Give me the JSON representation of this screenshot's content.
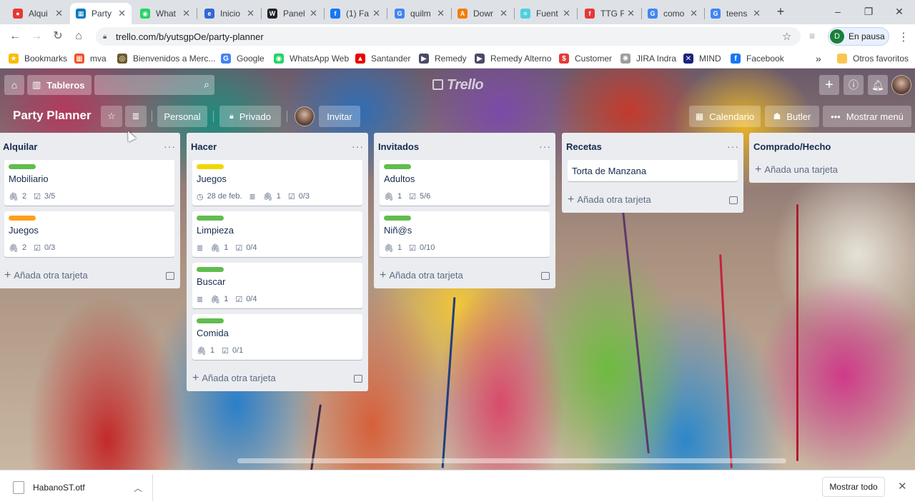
{
  "browser": {
    "tabs": [
      {
        "label": "Alqui",
        "color": "#e53935",
        "glyph": "●"
      },
      {
        "label": "Party",
        "color": "#0079bf",
        "glyph": "▦",
        "active": true
      },
      {
        "label": "What",
        "color": "#25d366",
        "glyph": "◉"
      },
      {
        "label": "Inicio",
        "color": "#3367d6",
        "glyph": "e"
      },
      {
        "label": "Panel",
        "color": "#222222",
        "glyph": "W"
      },
      {
        "label": "(1) Fa",
        "color": "#1877f2",
        "glyph": "f"
      },
      {
        "label": "quilm",
        "color": "#4285f4",
        "glyph": "G"
      },
      {
        "label": "Dowr",
        "color": "#f57c00",
        "glyph": "A"
      },
      {
        "label": "Fuent",
        "color": "#4dd0e1",
        "glyph": "≈"
      },
      {
        "label": "TTG F",
        "color": "#e53935",
        "glyph": "f"
      },
      {
        "label": "como",
        "color": "#4285f4",
        "glyph": "G"
      },
      {
        "label": "teens",
        "color": "#4285f4",
        "glyph": "G"
      }
    ],
    "url": "trello.com/b/yutsgpOe/party-planner",
    "profile": {
      "initial": "D",
      "status": "En pausa"
    },
    "bookmarks": [
      {
        "label": "Bookmarks",
        "color": "#fbbc04",
        "glyph": "★"
      },
      {
        "label": "mva",
        "color": "#f25022",
        "glyph": "▦"
      },
      {
        "label": "Bienvenidos a Merc...",
        "color": "#6b5b2a",
        "glyph": "◎"
      },
      {
        "label": "Google",
        "color": "#4285f4",
        "glyph": "G"
      },
      {
        "label": "WhatsApp Web",
        "color": "#25d366",
        "glyph": "◉"
      },
      {
        "label": "Santander",
        "color": "#ec0000",
        "glyph": "▲"
      },
      {
        "label": "Remedy",
        "color": "#4a4a6a",
        "glyph": "▶"
      },
      {
        "label": "Remedy Alterno",
        "color": "#4a4a6a",
        "glyph": "▶"
      },
      {
        "label": "Customer",
        "color": "#e53935",
        "glyph": "$"
      },
      {
        "label": "JIRA Indra",
        "color": "#9e9e9e",
        "glyph": "✺"
      },
      {
        "label": "MIND",
        "color": "#1a237e",
        "glyph": "✕"
      },
      {
        "label": "Facebook",
        "color": "#1877f2",
        "glyph": "f"
      }
    ],
    "bookmarks_more": "»",
    "other_favorites": "Otros favoritos"
  },
  "trello": {
    "tableros": "Tableros",
    "logo": "Trello",
    "board": {
      "title": "Party Planner",
      "personal": "Personal",
      "privado": "Privado",
      "invitar": "Invitar",
      "calendario": "Calendario",
      "butler": "Butler",
      "mostrar_menu": "Mostrar menú"
    },
    "lists": [
      {
        "title": "Alquilar",
        "add": "Añada otra tarjeta",
        "cards": [
          {
            "label": "#61bd4f",
            "title": "Mobiliario",
            "attachments": "2",
            "checklist": "3/5"
          },
          {
            "label": "#ff9f1a",
            "title": "Juegos",
            "attachments": "2",
            "checklist": "0/3"
          }
        ]
      },
      {
        "title": "Hacer",
        "add": "Añada otra tarjeta",
        "cards": [
          {
            "label": "#f2d600",
            "title": "Juegos",
            "due": "28 de feb.",
            "desc": true,
            "attachments": "1",
            "checklist": "0/3"
          },
          {
            "label": "#61bd4f",
            "title": "Limpieza",
            "desc": true,
            "attachments": "1",
            "checklist": "0/4"
          },
          {
            "label": "#61bd4f",
            "title": "Buscar",
            "desc": true,
            "attachments": "1",
            "checklist": "0/4"
          },
          {
            "label": "#61bd4f",
            "title": "Comida",
            "attachments": "1",
            "checklist": "0/1"
          }
        ]
      },
      {
        "title": "Invitados",
        "add": "Añada otra tarjeta",
        "cards": [
          {
            "label": "#61bd4f",
            "title": "Adultos",
            "attachments": "1",
            "checklist": "5/6"
          },
          {
            "label": "#61bd4f",
            "title": "Niñ@s",
            "attachments": "1",
            "checklist": "0/10"
          }
        ]
      },
      {
        "title": "Recetas",
        "add": "Añada otra tarjeta",
        "cards": [
          {
            "title": "Torta de Manzana"
          }
        ]
      },
      {
        "title": "Comprado/Hecho",
        "add": "Añada una tarjeta",
        "cards": []
      }
    ]
  },
  "download": {
    "filename": "HabanoST.otf",
    "show_all": "Mostrar todo"
  }
}
